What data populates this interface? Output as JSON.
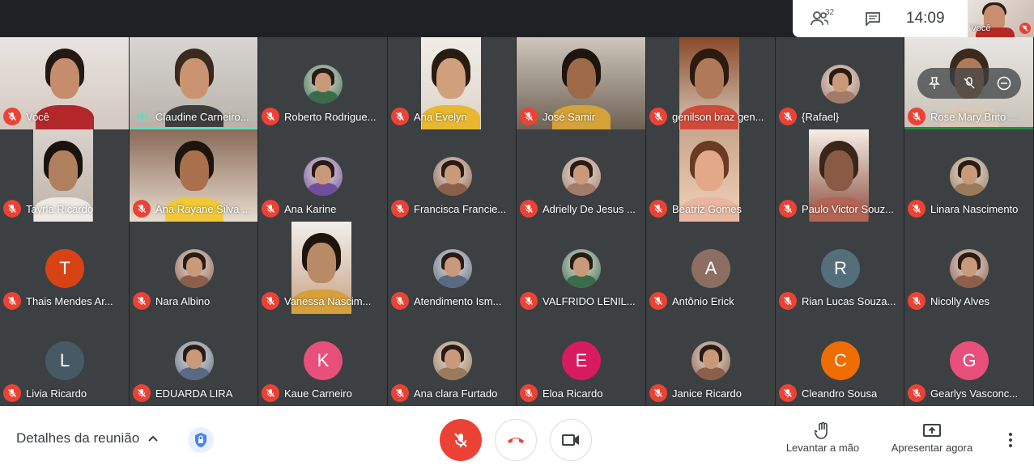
{
  "topbar": {
    "participants_count": "32",
    "clock": "14:09",
    "self_label": "Você"
  },
  "participants": [
    {
      "name": "Você",
      "type": "video",
      "mic": "off"
    },
    {
      "name": "Claudine Carneiro...",
      "type": "video",
      "mic": "speaking",
      "active": true
    },
    {
      "name": "Roberto Rodrigue...",
      "type": "photo",
      "mic": "off"
    },
    {
      "name": "Ana Evelyn",
      "type": "video",
      "mic": "off"
    },
    {
      "name": "José Samir",
      "type": "video",
      "mic": "off"
    },
    {
      "name": "genilson braz gen...",
      "type": "video",
      "mic": "off"
    },
    {
      "name": "{Rafael}",
      "type": "photo",
      "mic": "off"
    },
    {
      "name": "Rose Mary Brito ...",
      "type": "video",
      "mic": "off",
      "hover": true
    },
    {
      "name": "Tayrla Ricardo",
      "type": "video",
      "mic": "off"
    },
    {
      "name": "Ana Rayane Silva ...",
      "type": "video",
      "mic": "off"
    },
    {
      "name": "Ana Karine",
      "type": "photo",
      "mic": "off"
    },
    {
      "name": "Francisca Francie...",
      "type": "photo",
      "mic": "off"
    },
    {
      "name": "Adrielly De Jesus ...",
      "type": "photo",
      "mic": "off"
    },
    {
      "name": "Beatriz Gomes",
      "type": "video",
      "mic": "off"
    },
    {
      "name": "Paulo Victor Souz...",
      "type": "video",
      "mic": "off"
    },
    {
      "name": "Linara Nascimento",
      "type": "photo",
      "mic": "off"
    },
    {
      "name": "Thais Mendes Ar...",
      "type": "letter",
      "letter": "T",
      "color": "#d84315",
      "mic": "off"
    },
    {
      "name": "Nara Albino",
      "type": "photo",
      "mic": "off"
    },
    {
      "name": "Vanessa Nascim...",
      "type": "video",
      "mic": "off"
    },
    {
      "name": "Atendimento Ism...",
      "type": "photo",
      "mic": "off"
    },
    {
      "name": "VALFRIDO LENIL...",
      "type": "photo",
      "mic": "off"
    },
    {
      "name": "Antônio Erick",
      "type": "letter",
      "letter": "A",
      "color": "#8d6e63",
      "mic": "off"
    },
    {
      "name": "Rian Lucas Souza...",
      "type": "letter",
      "letter": "R",
      "color": "#546e7a",
      "mic": "off"
    },
    {
      "name": "Nicolly Alves",
      "type": "photo",
      "mic": "off"
    },
    {
      "name": "Livia Ricardo",
      "type": "letter",
      "letter": "L",
      "color": "#455a64",
      "mic": "off"
    },
    {
      "name": "EDUARDA LIRA",
      "type": "photo",
      "mic": "off"
    },
    {
      "name": "Kaue Carneiro",
      "type": "letter",
      "letter": "K",
      "color": "#e84f7a",
      "mic": "off"
    },
    {
      "name": "Ana clara Furtado",
      "type": "photo",
      "mic": "off"
    },
    {
      "name": "Eloa Ricardo",
      "type": "letter",
      "letter": "E",
      "color": "#d81b60",
      "mic": "off"
    },
    {
      "name": "Janice Ricardo",
      "type": "photo",
      "mic": "off"
    },
    {
      "name": "Cleandro Sousa",
      "type": "letter",
      "letter": "C",
      "color": "#ef6c00",
      "mic": "off"
    },
    {
      "name": "Gearlys Vasconc...",
      "type": "letter",
      "letter": "G",
      "color": "#e84f7a",
      "mic": "off"
    }
  ],
  "bottombar": {
    "details_label": "Detalhes da reunião",
    "raise_hand_label": "Levantar a mão",
    "present_label": "Apresentar agora"
  },
  "colors": {
    "mic_off": "#ea4335",
    "speaking": "#5ee0c1",
    "background": "#202124",
    "tile": "#3c4043"
  }
}
